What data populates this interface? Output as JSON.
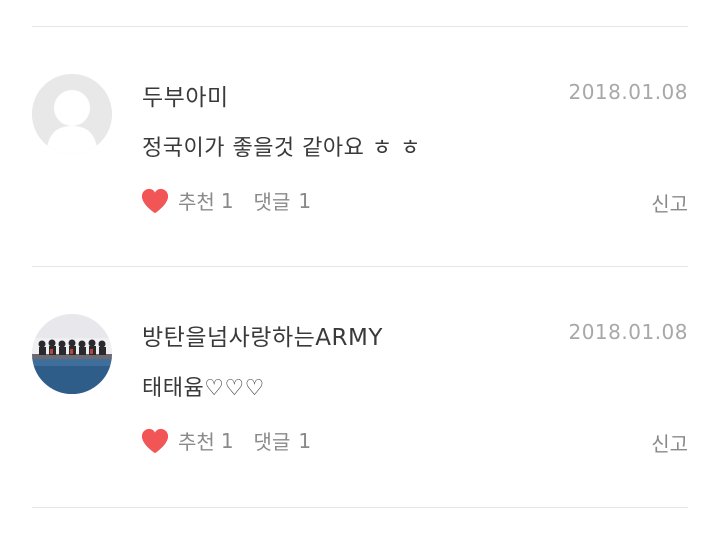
{
  "comments": [
    {
      "author": "두부아미",
      "date": "2018.01.08",
      "text": "정국이가 좋을것 같아요 ㅎ ㅎ",
      "like_label": "추천",
      "like_count": "1",
      "reply_label": "댓글",
      "reply_count": "1",
      "report_label": "신고",
      "avatar": "default-user-icon"
    },
    {
      "author": "방탄을넘사랑하는ARMY",
      "date": "2018.01.08",
      "text": "태태윰♡♡♡",
      "like_label": "추천",
      "like_count": "1",
      "reply_label": "댓글",
      "reply_count": "1",
      "report_label": "신고",
      "avatar": "group-photo"
    }
  ],
  "colors": {
    "heart": "#f25555",
    "divider": "#e6e6e6",
    "meta_text": "#8a8a8a",
    "date_text": "#a8a8a8"
  }
}
